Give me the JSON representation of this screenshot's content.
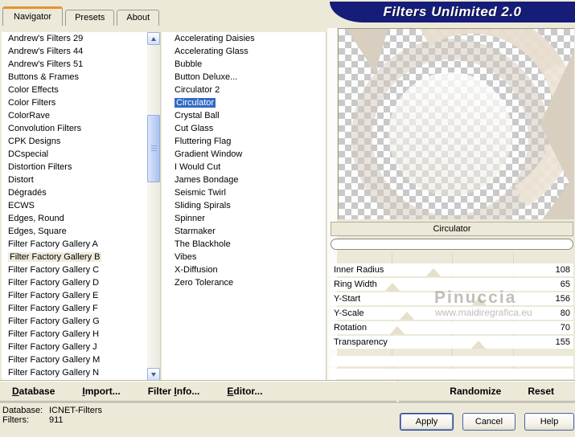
{
  "window": {
    "title": "Filters Unlimited 2.0"
  },
  "colors": {
    "dialog_beige": "#ECE9D8",
    "banner_navy": "#161D78",
    "selection_blue": "#316AC5",
    "inactive_selection": "#EFEBDC",
    "tab_accent_orange": "#E8912D"
  },
  "tabs": [
    {
      "label": "Navigator",
      "active": true
    },
    {
      "label": "Presets",
      "active": false
    },
    {
      "label": "About",
      "active": false
    }
  ],
  "category_list": {
    "selected": "Filter Factory Gallery B",
    "items": [
      "Andrew's Filters 29",
      "Andrew's Filters 44",
      "Andrew's Filters 51",
      "Buttons & Frames",
      "Color Effects",
      "Color Filters",
      "ColorRave",
      "Convolution Filters",
      "CPK Designs",
      "DCspecial",
      "Distortion Filters",
      "Distort",
      "Dégradés",
      "ECWS",
      "Edges, Round",
      "Edges, Square",
      "Filter Factory Gallery A",
      "Filter Factory Gallery B",
      "Filter Factory Gallery C",
      "Filter Factory Gallery D",
      "Filter Factory Gallery E",
      "Filter Factory Gallery F",
      "Filter Factory Gallery G",
      "Filter Factory Gallery H",
      "Filter Factory Gallery J",
      "Filter Factory Gallery M",
      "Filter Factory Gallery N"
    ]
  },
  "filter_list": {
    "selected": "Circulator",
    "items": [
      "Accelerating Daisies",
      "Accelerating Glass",
      "Bubble",
      "Button Deluxe...",
      "Circulator 2",
      "Circulator",
      "Crystal Ball",
      "Cut Glass",
      "Fluttering Flag",
      "Gradient Window",
      "I Would Cut",
      "James Bondage",
      "Seismic Twirl",
      "Sliding Spirals",
      "Spinner",
      "Starmaker",
      "The Blackhole",
      "Vibes",
      "X-Diffusion",
      "Zero Tolerance"
    ]
  },
  "preview": {
    "filter_name": "Circulator"
  },
  "slider_max": 255,
  "empty_rows": 2,
  "sliders": [
    {
      "label": "Inner Radius",
      "value": 108
    },
    {
      "label": "Ring Width",
      "value": 65
    },
    {
      "label": "Y-Start",
      "value": 156
    },
    {
      "label": "Y-Scale",
      "value": 80
    },
    {
      "label": "Rotation",
      "value": 70
    },
    {
      "label": "Transparency",
      "value": 155
    }
  ],
  "watermark": {
    "line1": "Pinuccia",
    "line2": "www.maidiregrafica.eu"
  },
  "toolbar": {
    "left": [
      {
        "label": "Database",
        "accel_index": 0
      },
      {
        "label": "Import...",
        "accel_index": 0
      },
      {
        "label": "Filter Info...",
        "accel_index": 7
      },
      {
        "label": "Editor...",
        "accel_index": 0
      }
    ],
    "right": [
      {
        "label": "Randomize",
        "accel_index": -1
      },
      {
        "label": "Reset",
        "accel_index": -1
      }
    ]
  },
  "status": [
    {
      "label": "Database:",
      "value": "ICNET-Filters"
    },
    {
      "label": "Filters:",
      "value": "911"
    }
  ],
  "buttons": [
    {
      "id": "apply",
      "label": "Apply",
      "default": true
    },
    {
      "id": "cancel",
      "label": "Cancel",
      "default": false
    },
    {
      "id": "help",
      "label": "Help",
      "default": false
    }
  ]
}
